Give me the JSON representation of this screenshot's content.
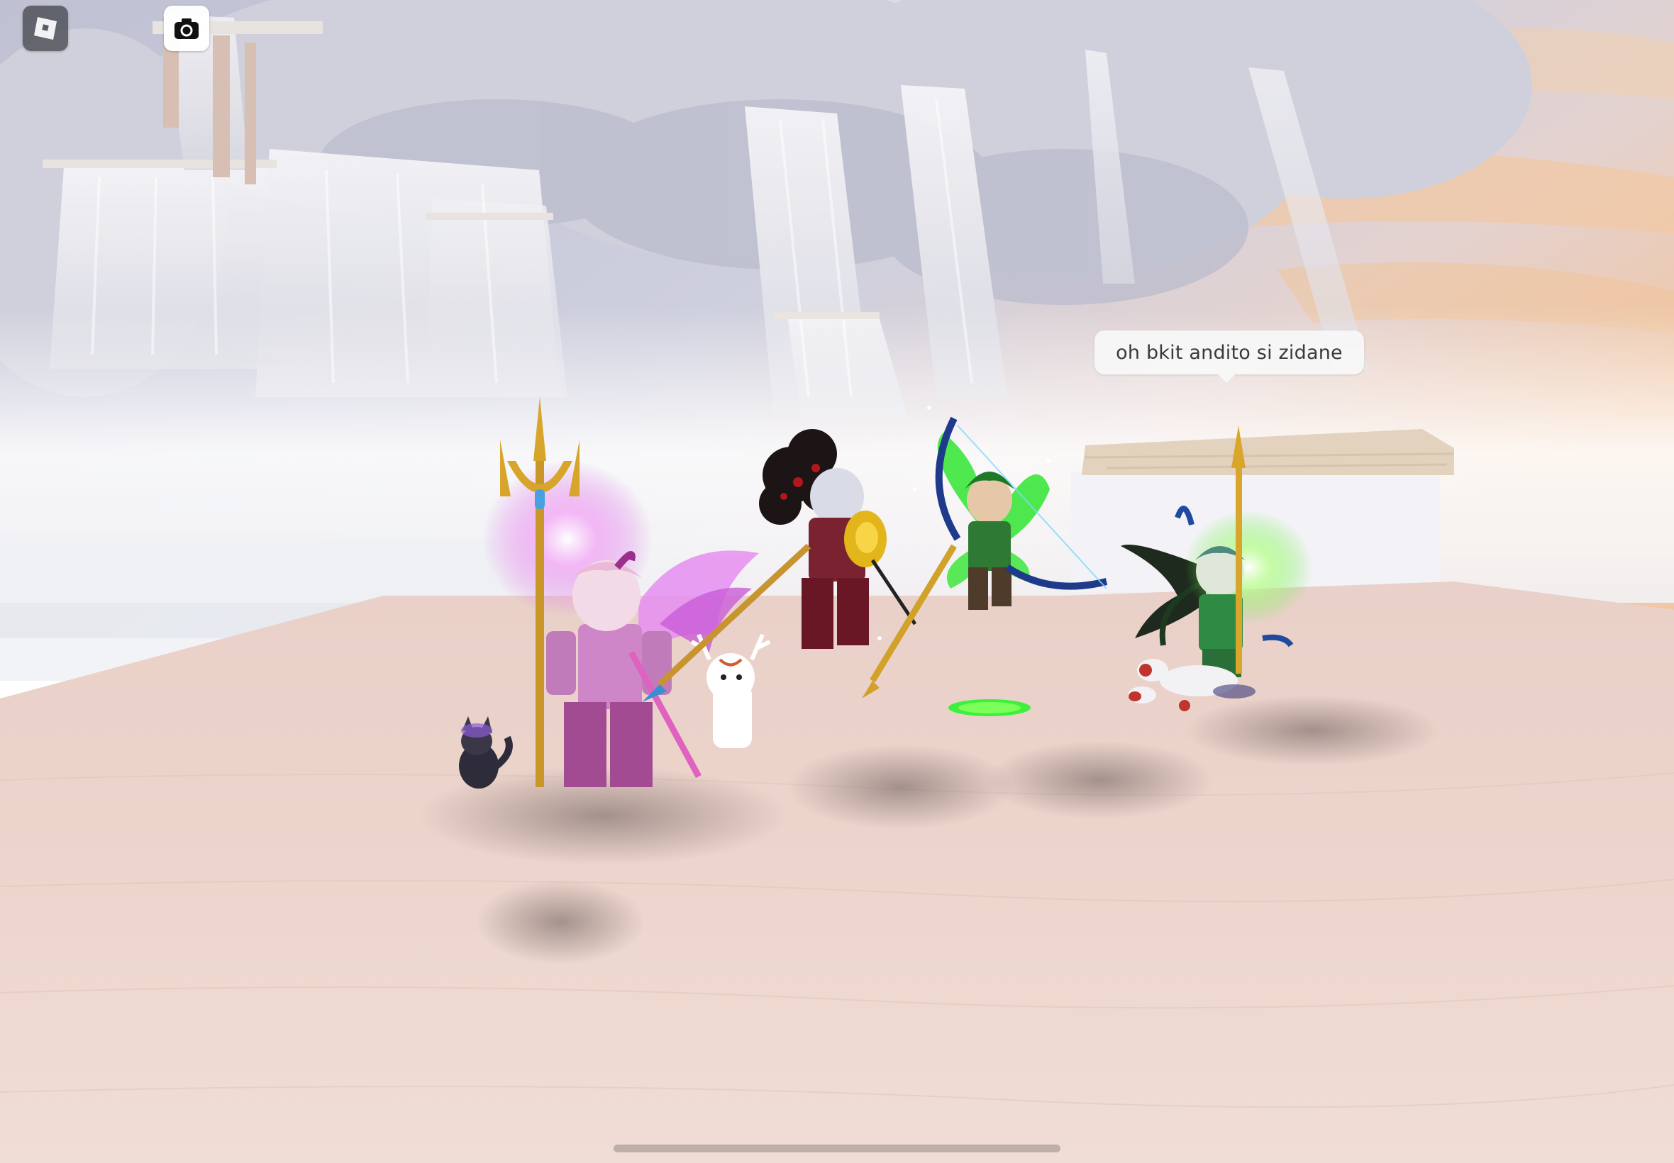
{
  "hud": {
    "menu_icon": "roblox-logo-icon",
    "screenshot_icon": "camera-icon"
  },
  "chat": {
    "bubble_text": "oh bkit andito si zidane"
  },
  "colors": {
    "ground": "#ecd3cb",
    "sky": "#c9cbdc",
    "clouds": "#d7d8e2",
    "sunset": "#f4c9a0",
    "magic_pink": "#e07ce8",
    "magic_green": "#4cf23a",
    "gold": "#d8a62a"
  }
}
